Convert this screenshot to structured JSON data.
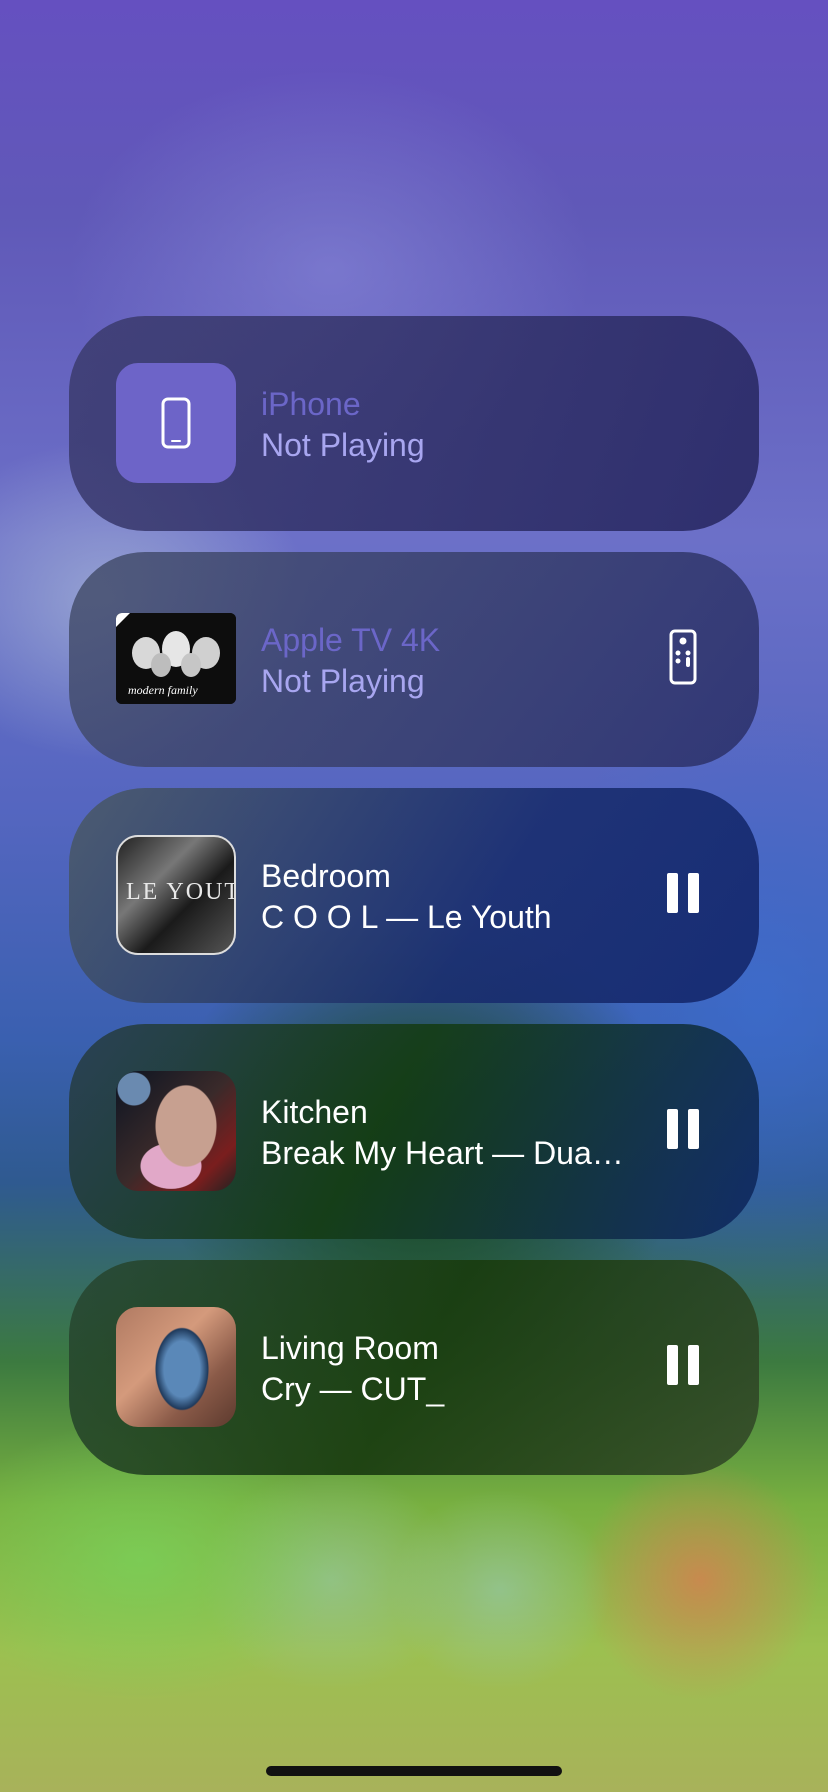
{
  "devices": [
    {
      "id": "iphone",
      "name": "iPhone",
      "status": "Not Playing",
      "artwork_icon": "iphone-device-icon",
      "action_icon": null
    },
    {
      "id": "apple-tv",
      "name": "Apple TV 4K",
      "status": "Not Playing",
      "artwork_text": "modern family",
      "action_icon": "remote-icon"
    },
    {
      "id": "bedroom",
      "name": "Bedroom",
      "status": "C O O L — Le Youth",
      "artwork_text": "LE YOUTH",
      "action_icon": "pause-icon"
    },
    {
      "id": "kitchen",
      "name": "Kitchen",
      "status": "Break My Heart — Dua…",
      "action_icon": "pause-icon"
    },
    {
      "id": "living-room",
      "name": "Living Room",
      "status": "Cry — CUT_",
      "action_icon": "pause-icon"
    }
  ],
  "colors": {
    "inactive_title": "#6b66c8",
    "inactive_status": "#a8a6f0",
    "active_text": "#ffffff",
    "iphone_tile": "#6d64c8"
  }
}
